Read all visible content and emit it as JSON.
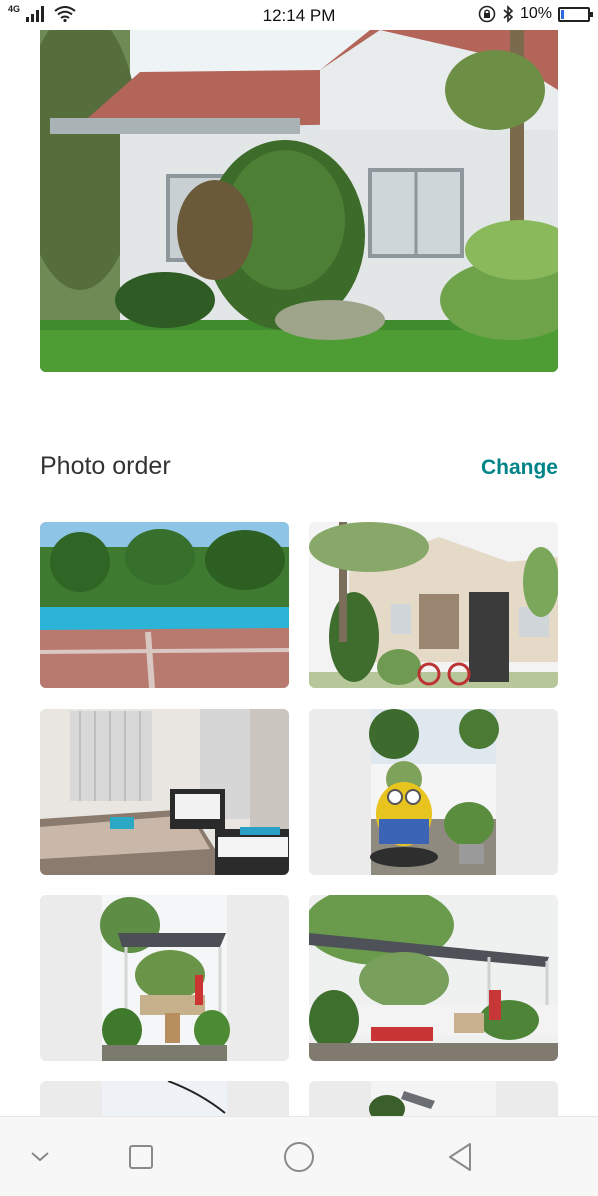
{
  "status_bar": {
    "network": "4G",
    "time": "12:14 PM",
    "battery_text": "10%",
    "battery_level": 0.1
  },
  "photo_order": {
    "title": "Photo order",
    "change_label": "Change"
  },
  "photos": [
    {
      "icon": "pool-photo"
    },
    {
      "icon": "house-exterior-photo"
    },
    {
      "icon": "bedroom-photo"
    },
    {
      "icon": "minion-planter-photo"
    },
    {
      "icon": "garden-shade-photo"
    },
    {
      "icon": "garden-plants-photo"
    },
    {
      "icon": "garden-photo"
    },
    {
      "icon": "garden-photo"
    }
  ],
  "colors": {
    "accent": "#00848a",
    "title_text": "#333333",
    "thumb_placeholder": "#ebebeb",
    "nav_bar": "#f7f7f7"
  }
}
